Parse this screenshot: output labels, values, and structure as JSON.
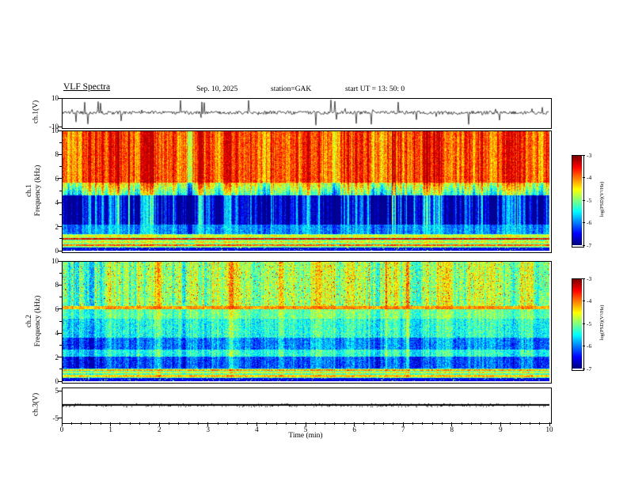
{
  "header": {
    "title": "VLF Spectra",
    "date": "Sep. 10, 2025",
    "station": "station=GAK",
    "start_ut": "start UT =  13: 50: 0"
  },
  "axes": {
    "time_label": "Time (min)",
    "time_ticks": [
      "0",
      "1",
      "2",
      "3",
      "4",
      "5",
      "6",
      "7",
      "8",
      "9",
      "10"
    ],
    "time_minor_per_major": 5,
    "freq_ticks": [
      "0",
      "2",
      "4",
      "6",
      "8",
      "10"
    ],
    "freq_minor_ticks": [
      1,
      3,
      5,
      7,
      9
    ],
    "ch1_wave_label": "ch.1(V)",
    "ch1_wave_tick_labels": [
      "10",
      "-10"
    ],
    "ch1_spec_label_line1": "ch.1",
    "ch1_spec_label_line2": "Frequency (kHz)",
    "ch2_spec_label_line1": "ch.2",
    "ch2_spec_label_line2": "Frequency (kHz)",
    "ch3_wave_label": "ch.3(V)",
    "ch3_wave_tick_labels": [
      "5",
      "-5"
    ]
  },
  "colorbar": {
    "label": "log(PSD)(V²/Hz)",
    "tick_labels": [
      "-3",
      "-4",
      "-5",
      "-6",
      "-7"
    ]
  },
  "colors": {
    "background": "#ffffff",
    "axis": "#000000",
    "trace": "#000000",
    "colormap": "jet",
    "colormap_low": "#00007f",
    "colormap_high": "#7f0000"
  },
  "chart_data": [
    {
      "type": "line",
      "name": "ch1_waveform",
      "ylabel": "ch.1(V)",
      "xlim": [
        0,
        10
      ],
      "ylim": [
        -10,
        10
      ],
      "yticks": [
        10,
        -10
      ],
      "description": "Broadband noisy voltage trace centered on 0 V with dense impulsive spikes reaching about ±10 V throughout the 10-minute record",
      "sim": {
        "seed": 1309,
        "noise_amp": 1.2,
        "spike_prob": 0.06,
        "spike_amp": 9.0
      }
    },
    {
      "type": "heatmap",
      "name": "ch1_spectrogram",
      "ylabel": "ch.1 Frequency (kHz)",
      "xlabel": "Time (min)",
      "xlim": [
        0,
        10
      ],
      "ylim": [
        0,
        10
      ],
      "yticks": [
        0,
        2,
        4,
        6,
        8,
        10
      ],
      "zlabel": "log(PSD)(V²/Hz)",
      "zlim": [
        -7,
        -3
      ],
      "legend_position": "colorbar-right",
      "description": "Intense red/orange band above ~5.5 kHz with strong vertical striping, dark blue/near-black region 2.2-4.6 kHz crossed by vertical cyan/green streaks, bright horizontal emission lines between 0.3 and 1.3 kHz (strongest near 0.95 kHz), near-black strip below 0.2 kHz",
      "bands": [
        {
          "f0": 0.0,
          "f1": 0.22,
          "psd": -6.6,
          "jit": 0.06,
          "col": 0.0,
          "fleck": 0.1
        },
        {
          "f0": 0.22,
          "f1": 1.35,
          "psd": -5.0,
          "jit": 0.1,
          "col": 0.06,
          "lw": 0.07,
          "lines": [
            [
              0.45,
              -3.9
            ],
            [
              0.7,
              -4.5
            ],
            [
              0.95,
              -3.4
            ],
            [
              1.2,
              -4.6
            ]
          ]
        },
        {
          "f0": 1.35,
          "f1": 2.15,
          "psd": -5.9,
          "jit": 0.09,
          "col": 0.16
        },
        {
          "f0": 2.15,
          "f1": 4.6,
          "psd": -6.6,
          "jit": 0.07,
          "col": 0.42
        },
        {
          "f0": 4.6,
          "f1": 5.7,
          "psd": -5.3,
          "jit": 0.11,
          "col": 0.3,
          "ramp": 0.22
        },
        {
          "f0": 5.7,
          "f1": 10.0,
          "psd": -3.8,
          "jit": 0.09,
          "col": 0.22
        }
      ],
      "sim": {
        "seed": 42
      }
    },
    {
      "type": "heatmap",
      "name": "ch2_spectrogram",
      "ylabel": "ch.2 Frequency (kHz)",
      "xlabel": "Time (min)",
      "xlim": [
        0,
        10
      ],
      "ylim": [
        0,
        10
      ],
      "yticks": [
        0,
        2,
        4,
        6,
        8,
        10
      ],
      "zlabel": "log(PSD)(V²/Hz)",
      "zlim": [
        -7,
        -3
      ],
      "legend_position": "colorbar-right",
      "description": "Cooler green/cyan spectrogram: green-yellow upper region above 6.3 kHz with vertical yellow bursts, distinct yellow/orange horizontal line near 6.0-6.3 kHz, alternating cyan-green and dark blue horizontal bands below 5 kHz, green emission lines 0.3-1.0 kHz, near-black strip below 0.2 kHz",
      "bands": [
        {
          "f0": 0.0,
          "f1": 0.22,
          "psd": -6.6,
          "jit": 0.06,
          "col": 0.0,
          "fleck": 0.1
        },
        {
          "f0": 0.22,
          "f1": 1.05,
          "psd": -5.2,
          "jit": 0.1,
          "col": 0.07,
          "lw": 0.07,
          "lines": [
            [
              0.4,
              -4.3
            ],
            [
              0.68,
              -4.6
            ],
            [
              0.92,
              -4.2
            ]
          ]
        },
        {
          "f0": 1.05,
          "f1": 2.0,
          "psd": -6.2,
          "jit": 0.1,
          "col": 0.16
        },
        {
          "f0": 2.0,
          "f1": 2.6,
          "psd": -5.4,
          "jit": 0.1,
          "col": 0.13
        },
        {
          "f0": 2.6,
          "f1": 3.6,
          "psd": -6.0,
          "jit": 0.1,
          "col": 0.16
        },
        {
          "f0": 3.6,
          "f1": 5.2,
          "psd": -5.4,
          "jit": 0.11,
          "col": 0.13
        },
        {
          "f0": 5.2,
          "f1": 6.0,
          "psd": -5.1,
          "jit": 0.1,
          "col": 0.12
        },
        {
          "f0": 6.0,
          "f1": 6.3,
          "psd": -4.1,
          "jit": 0.07,
          "col": 0.08
        },
        {
          "f0": 6.3,
          "f1": 10.0,
          "psd": -4.9,
          "jit": 0.12,
          "col": 0.2,
          "fleck": 0.04
        }
      ],
      "sim": {
        "seed": 77
      }
    },
    {
      "type": "line",
      "name": "ch3_waveform",
      "ylabel": "ch.3(V)",
      "xlim": [
        0,
        10
      ],
      "ylim": [
        -6.25,
        6.25
      ],
      "yticks": [
        5,
        -5
      ],
      "description": "Constant flat trace at 0 V for the entire interval (channel quiet)",
      "sim": {
        "seed": 9,
        "flat_value": 0
      }
    }
  ]
}
